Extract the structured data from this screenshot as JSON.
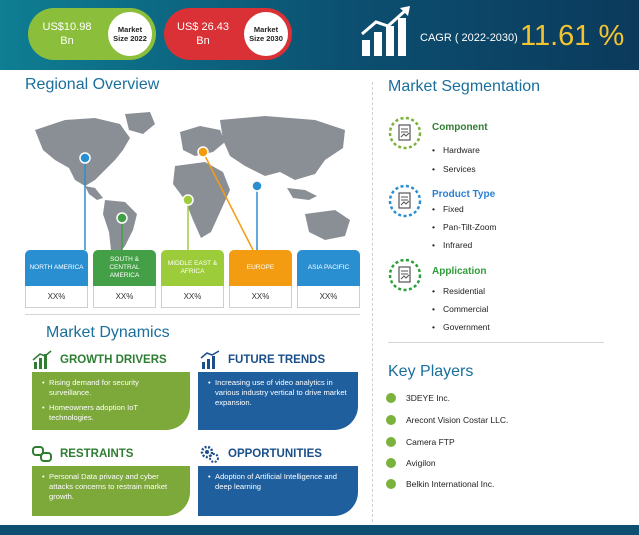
{
  "header": {
    "market_2022": {
      "value": "US$10.98\nBn",
      "label": "Market\nSize 2022",
      "color": "#8bbf3b"
    },
    "market_2030": {
      "value": "US$ 26.43\nBn",
      "label": "Market\nSize 2030",
      "color": "#d93135"
    },
    "cagr_label": "CAGR ( 2022-2030)",
    "cagr_value": "11.61 %"
  },
  "regional": {
    "title": "Regional Overview",
    "regions": [
      {
        "name": "NORTH AMERICA",
        "value": "XX%",
        "color": "#2a8fd0"
      },
      {
        "name": "SOUTH & CENTRAL AMERICA",
        "value": "XX%",
        "color": "#43a047"
      },
      {
        "name": "MIDDLE EAST & AFRICA",
        "value": "XX%",
        "color": "#9ccc3a"
      },
      {
        "name": "EUROPE",
        "value": "XX%",
        "color": "#f39c12"
      },
      {
        "name": "ASIA PACIFIC",
        "value": "XX%",
        "color": "#2a8fd0"
      }
    ]
  },
  "dynamics": {
    "title": "Market Dynamics",
    "growth_drivers": {
      "title": "GROWTH DRIVERS",
      "items": [
        "Rising  demand for security surveillance.",
        "Homeowners adoption IoT technologies."
      ]
    },
    "future_trends": {
      "title": "FUTURE TRENDS",
      "items": [
        "Increasing use of video analytics in various industry vertical to drive market expansion."
      ]
    },
    "restraints": {
      "title": "RESTRAINTS",
      "items": [
        "Personal Data privacy and cyber attacks concerns to restrain market growth."
      ]
    },
    "opportunities": {
      "title": "OPPORTUNITIES",
      "items": [
        "Adoption of Artificial Intelligence and deep learning"
      ]
    }
  },
  "segmentation": {
    "title": "Market Segmentation",
    "groups": [
      {
        "title": "Component",
        "color": "#2e7d32",
        "items": [
          "Hardware",
          "Services"
        ]
      },
      {
        "title": "Product Type",
        "color": "#2a7fd0",
        "items": [
          "Fixed",
          "Pan-Tilt-Zoom",
          "Infrared"
        ]
      },
      {
        "title": "Application",
        "color": "#2e9e3a",
        "items": [
          "Residential",
          "Commercial",
          "Government"
        ]
      }
    ]
  },
  "key_players": {
    "title": "Key Players",
    "items": [
      "3DEYE Inc.",
      "Arecont Vision Costar LLC.",
      "Camera FTP",
      "Avigilon",
      "Belkin International Inc."
    ]
  },
  "icons": {
    "growth": "bar-chart-icon",
    "trends": "trend-chart-icon",
    "restraints": "chain-link-icon",
    "opportunities": "gears-icon",
    "segmentation": "document-chart-icon"
  }
}
